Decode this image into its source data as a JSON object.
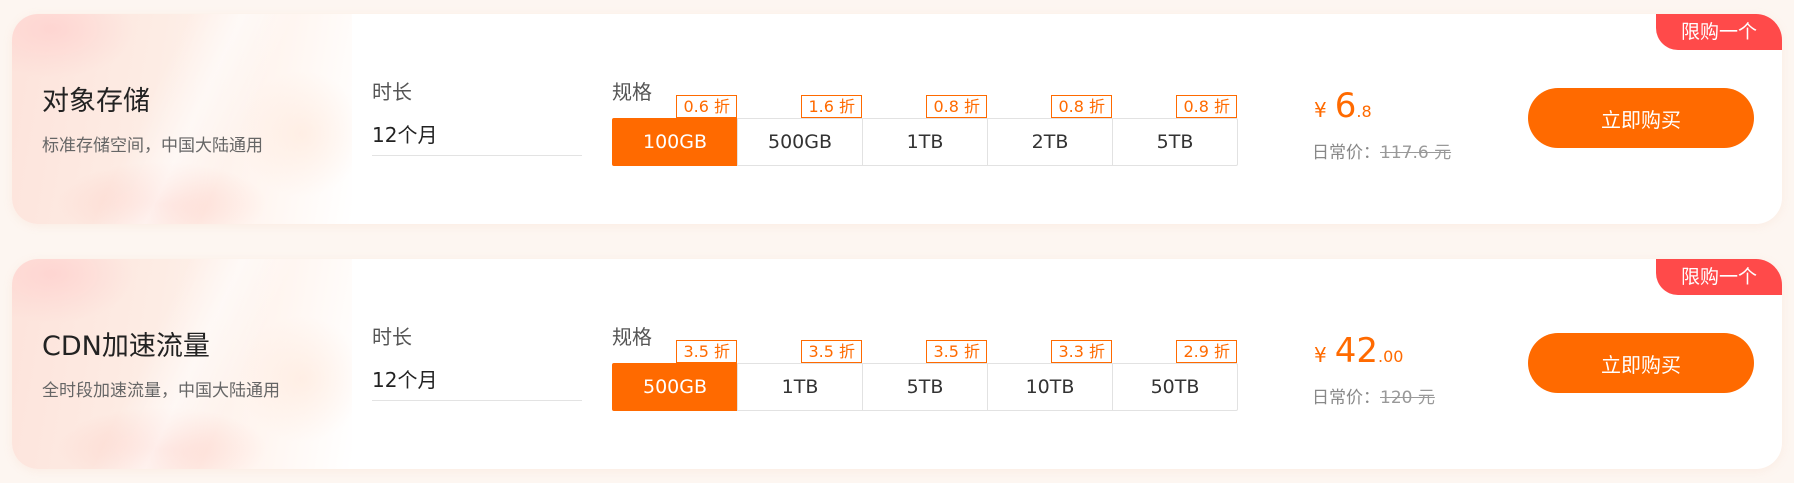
{
  "products": [
    {
      "name": "对象存储",
      "description": "标准存储空间，中国大陆通用",
      "limit_badge": "限购一个",
      "duration_label": "时长",
      "duration_value": "12个月",
      "spec_label": "规格",
      "specs": [
        {
          "label": "100GB",
          "discount": "0.6 折",
          "selected": true
        },
        {
          "label": "500GB",
          "discount": "1.6 折",
          "selected": false
        },
        {
          "label": "1TB",
          "discount": "0.8 折",
          "selected": false
        },
        {
          "label": "2TB",
          "discount": "0.8 折",
          "selected": false
        },
        {
          "label": "5TB",
          "discount": "0.8 折",
          "selected": false
        }
      ],
      "currency_symbol": "¥",
      "price_int": "6",
      "price_dec": ".8",
      "original_label": "日常价：",
      "original_price": "117.6 元",
      "buy_label": "立即购买"
    },
    {
      "name": "CDN加速流量",
      "description": "全时段加速流量，中国大陆通用",
      "limit_badge": "限购一个",
      "duration_label": "时长",
      "duration_value": "12个月",
      "spec_label": "规格",
      "specs": [
        {
          "label": "500GB",
          "discount": "3.5 折",
          "selected": true
        },
        {
          "label": "1TB",
          "discount": "3.5 折",
          "selected": false
        },
        {
          "label": "5TB",
          "discount": "3.5 折",
          "selected": false
        },
        {
          "label": "10TB",
          "discount": "3.3 折",
          "selected": false
        },
        {
          "label": "50TB",
          "discount": "2.9 折",
          "selected": false
        }
      ],
      "currency_symbol": "¥",
      "price_int": "42",
      "price_dec": ".00",
      "original_label": "日常价：",
      "original_price": "120 元",
      "buy_label": "立即购买"
    }
  ],
  "colors": {
    "accent": "#ff6a00",
    "badge": "#ff4a4a"
  }
}
